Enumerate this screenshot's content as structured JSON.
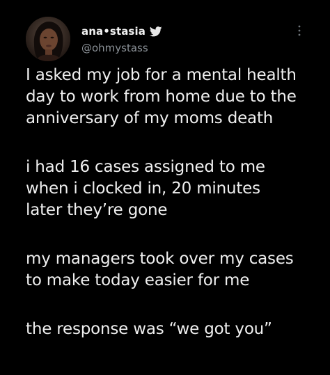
{
  "author": {
    "display_name": "ana•stasia",
    "handle": "@ohmystass",
    "avatar_icon": "avatar-photo",
    "verified_icon": "bird-icon"
  },
  "colors": {
    "background": "#000000",
    "text": "#efefef",
    "handle": "#8b9197"
  },
  "menu_icon": "more-vertical-icon",
  "tweet": {
    "paragraphs": [
      "I asked my job for a mental health\nday to work from home due to the\nanniversary of my moms death",
      "i had 16 cases assigned to me\nwhen i clocked in, 20 minutes\nlater they’re gone",
      "my managers took over my cases\nto make today easier for me",
      "the response was “we got you”"
    ]
  }
}
